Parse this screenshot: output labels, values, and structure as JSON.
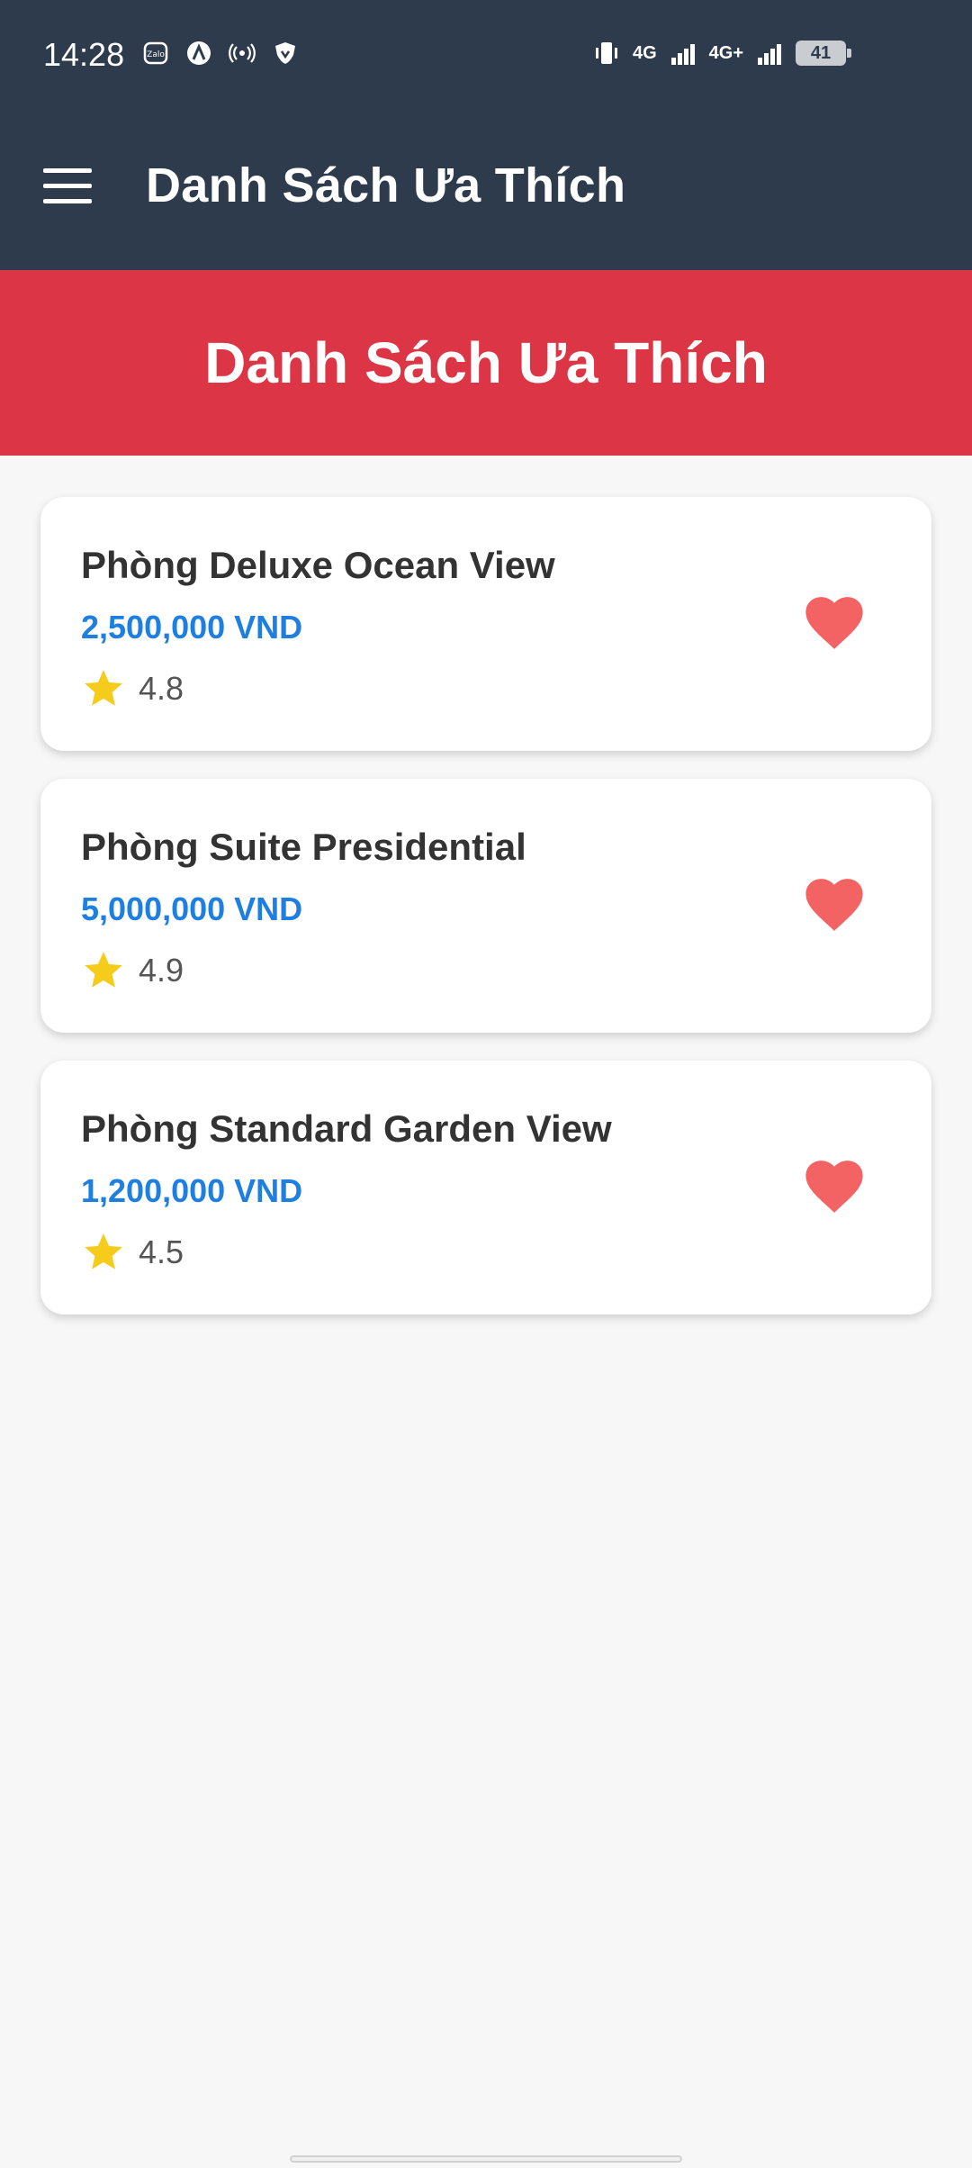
{
  "status_bar": {
    "time": "14:28",
    "left_icons": [
      "zalo-icon",
      "a-circle-icon",
      "hotspot-icon",
      "vpn-shield-icon"
    ],
    "network_1": "4G",
    "network_2": "4G+",
    "battery": "41"
  },
  "app_bar": {
    "title": "Danh Sách Ưa Thích",
    "menu_icon": "hamburger-menu-icon"
  },
  "banner": {
    "title": "Danh Sách Ưa Thích",
    "color": "#dc3545"
  },
  "favorites": [
    {
      "name": "Phòng Deluxe Ocean View",
      "price": "2,500,000 VND",
      "rating": "4.8"
    },
    {
      "name": "Phòng Suite Presidential",
      "price": "5,000,000 VND",
      "rating": "4.9"
    },
    {
      "name": "Phòng Standard Garden View",
      "price": "1,200,000 VND",
      "rating": "4.5"
    }
  ],
  "colors": {
    "header": "#2d3b4d",
    "price": "#1e7fe0",
    "heart": "#f36363",
    "star": "#f5cc1c"
  }
}
